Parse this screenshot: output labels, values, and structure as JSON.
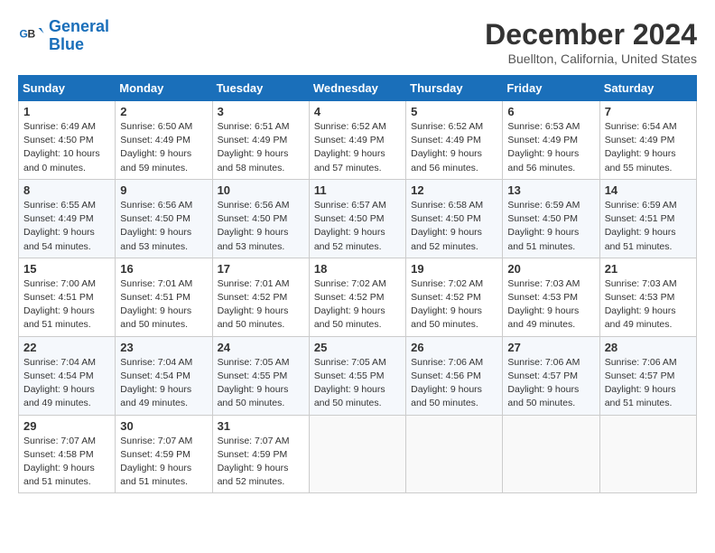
{
  "logo": {
    "line1": "General",
    "line2": "Blue"
  },
  "title": "December 2024",
  "subtitle": "Buellton, California, United States",
  "days_of_week": [
    "Sunday",
    "Monday",
    "Tuesday",
    "Wednesday",
    "Thursday",
    "Friday",
    "Saturday"
  ],
  "weeks": [
    [
      {
        "day": 1,
        "sunrise": "6:49 AM",
        "sunset": "4:50 PM",
        "daylight": "10 hours and 0 minutes."
      },
      {
        "day": 2,
        "sunrise": "6:50 AM",
        "sunset": "4:49 PM",
        "daylight": "9 hours and 59 minutes."
      },
      {
        "day": 3,
        "sunrise": "6:51 AM",
        "sunset": "4:49 PM",
        "daylight": "9 hours and 58 minutes."
      },
      {
        "day": 4,
        "sunrise": "6:52 AM",
        "sunset": "4:49 PM",
        "daylight": "9 hours and 57 minutes."
      },
      {
        "day": 5,
        "sunrise": "6:52 AM",
        "sunset": "4:49 PM",
        "daylight": "9 hours and 56 minutes."
      },
      {
        "day": 6,
        "sunrise": "6:53 AM",
        "sunset": "4:49 PM",
        "daylight": "9 hours and 56 minutes."
      },
      {
        "day": 7,
        "sunrise": "6:54 AM",
        "sunset": "4:49 PM",
        "daylight": "9 hours and 55 minutes."
      }
    ],
    [
      {
        "day": 8,
        "sunrise": "6:55 AM",
        "sunset": "4:49 PM",
        "daylight": "9 hours and 54 minutes."
      },
      {
        "day": 9,
        "sunrise": "6:56 AM",
        "sunset": "4:50 PM",
        "daylight": "9 hours and 53 minutes."
      },
      {
        "day": 10,
        "sunrise": "6:56 AM",
        "sunset": "4:50 PM",
        "daylight": "9 hours and 53 minutes."
      },
      {
        "day": 11,
        "sunrise": "6:57 AM",
        "sunset": "4:50 PM",
        "daylight": "9 hours and 52 minutes."
      },
      {
        "day": 12,
        "sunrise": "6:58 AM",
        "sunset": "4:50 PM",
        "daylight": "9 hours and 52 minutes."
      },
      {
        "day": 13,
        "sunrise": "6:59 AM",
        "sunset": "4:50 PM",
        "daylight": "9 hours and 51 minutes."
      },
      {
        "day": 14,
        "sunrise": "6:59 AM",
        "sunset": "4:51 PM",
        "daylight": "9 hours and 51 minutes."
      }
    ],
    [
      {
        "day": 15,
        "sunrise": "7:00 AM",
        "sunset": "4:51 PM",
        "daylight": "9 hours and 51 minutes."
      },
      {
        "day": 16,
        "sunrise": "7:01 AM",
        "sunset": "4:51 PM",
        "daylight": "9 hours and 50 minutes."
      },
      {
        "day": 17,
        "sunrise": "7:01 AM",
        "sunset": "4:52 PM",
        "daylight": "9 hours and 50 minutes."
      },
      {
        "day": 18,
        "sunrise": "7:02 AM",
        "sunset": "4:52 PM",
        "daylight": "9 hours and 50 minutes."
      },
      {
        "day": 19,
        "sunrise": "7:02 AM",
        "sunset": "4:52 PM",
        "daylight": "9 hours and 50 minutes."
      },
      {
        "day": 20,
        "sunrise": "7:03 AM",
        "sunset": "4:53 PM",
        "daylight": "9 hours and 49 minutes."
      },
      {
        "day": 21,
        "sunrise": "7:03 AM",
        "sunset": "4:53 PM",
        "daylight": "9 hours and 49 minutes."
      }
    ],
    [
      {
        "day": 22,
        "sunrise": "7:04 AM",
        "sunset": "4:54 PM",
        "daylight": "9 hours and 49 minutes."
      },
      {
        "day": 23,
        "sunrise": "7:04 AM",
        "sunset": "4:54 PM",
        "daylight": "9 hours and 49 minutes."
      },
      {
        "day": 24,
        "sunrise": "7:05 AM",
        "sunset": "4:55 PM",
        "daylight": "9 hours and 50 minutes."
      },
      {
        "day": 25,
        "sunrise": "7:05 AM",
        "sunset": "4:55 PM",
        "daylight": "9 hours and 50 minutes."
      },
      {
        "day": 26,
        "sunrise": "7:06 AM",
        "sunset": "4:56 PM",
        "daylight": "9 hours and 50 minutes."
      },
      {
        "day": 27,
        "sunrise": "7:06 AM",
        "sunset": "4:57 PM",
        "daylight": "9 hours and 50 minutes."
      },
      {
        "day": 28,
        "sunrise": "7:06 AM",
        "sunset": "4:57 PM",
        "daylight": "9 hours and 51 minutes."
      }
    ],
    [
      {
        "day": 29,
        "sunrise": "7:07 AM",
        "sunset": "4:58 PM",
        "daylight": "9 hours and 51 minutes."
      },
      {
        "day": 30,
        "sunrise": "7:07 AM",
        "sunset": "4:59 PM",
        "daylight": "9 hours and 51 minutes."
      },
      {
        "day": 31,
        "sunrise": "7:07 AM",
        "sunset": "4:59 PM",
        "daylight": "9 hours and 52 minutes."
      },
      null,
      null,
      null,
      null
    ]
  ]
}
